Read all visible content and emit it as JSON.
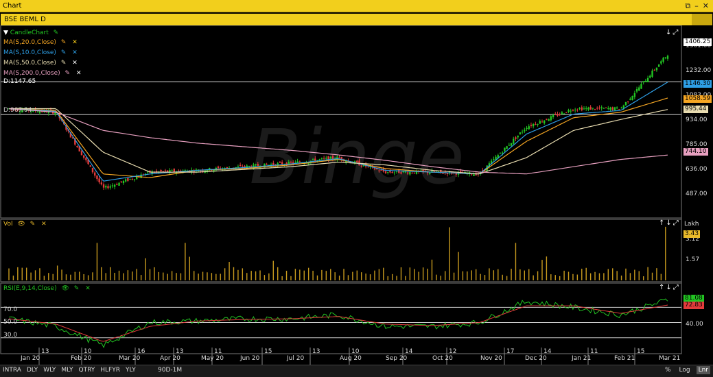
{
  "window": {
    "title": "Chart",
    "header": "BSE BEML D"
  },
  "legend": {
    "candle": "CandleChart",
    "ma": [
      {
        "label": "MA(S,20.0,Close)",
        "color": "#f5a623"
      },
      {
        "label": "MA(S,10.0,Close)",
        "color": "#2e9fe6"
      },
      {
        "label": "MA(S,50.0,Close)",
        "color": "#e8dcb0"
      },
      {
        "label": "MA(S,200.0,Close)",
        "color": "#e8a0c0"
      }
    ],
    "dline": "D:1147.65",
    "dline2": "D:967.94"
  },
  "price_axis": {
    "labels": [
      "1361.00",
      "1232.00",
      "1083.00",
      "934.00",
      "785.00",
      "636.00",
      "487.00"
    ],
    "tags": [
      {
        "text": "1406.25",
        "color": "#ffffff"
      },
      {
        "text": "1146.30",
        "color": "#2e9fe6"
      },
      {
        "text": "1058.59",
        "color": "#f5a623"
      },
      {
        "text": "995.44",
        "color": "#e8dcb0"
      },
      {
        "text": "744.10",
        "color": "#e8a0c0"
      }
    ]
  },
  "vol": {
    "label": "Vol",
    "unit": "Lakh",
    "axis": [
      "3.12",
      "1.57"
    ],
    "tag": "3.43"
  },
  "rsi": {
    "label": "RSI(E,9,14,Close)",
    "levels": [
      "70.0",
      "50.0",
      "30.0"
    ],
    "axis": "40.00",
    "tags": [
      {
        "text": "81.08",
        "color": "#22c422"
      },
      {
        "text": "72.83",
        "color": "#e23b3b"
      }
    ]
  },
  "xaxis": {
    "days": [
      "13",
      "10",
      "16",
      "13",
      "11",
      "15",
      "13",
      "10",
      "14",
      "12",
      "17",
      "14",
      "11",
      "15"
    ],
    "months": [
      "Jan 20",
      "Feb 20",
      "Mar 20",
      "Apr 20",
      "May 20",
      "Jun 20",
      "Jul 20",
      "Aug 20",
      "Sep 20",
      "Oct 20",
      "Nov 20",
      "Dec 20",
      "Jan 21",
      "Feb 21",
      "Mar 21"
    ]
  },
  "watermark": "Binge",
  "bottom": {
    "timeframes": [
      "INTRA",
      "DLY",
      "WLY",
      "MLY",
      "QTRY",
      "HLFYR",
      "YLY"
    ],
    "range": "90D-1M",
    "scale": [
      "%",
      "Log",
      "Lnr"
    ]
  },
  "chart_data": {
    "type": "line",
    "title": "BSE BEML D",
    "x": [
      "Jan 20",
      "Feb 20",
      "Mar 20",
      "Apr 20",
      "May 20",
      "Jun 20",
      "Jul 20",
      "Aug 20",
      "Sep 20",
      "Oct 20",
      "Nov 20",
      "Dec 20",
      "Jan 21",
      "Feb 21",
      "Mar 21"
    ],
    "series": [
      {
        "name": "CandleChart",
        "values": [
          1000,
          980,
          560,
          650,
          660,
          680,
          700,
          730,
          650,
          650,
          640,
          900,
          1000,
          1000,
          1300
        ]
      },
      {
        "name": "MA(S,20.0,Close)",
        "values": [
          1000,
          990,
          640,
          620,
          660,
          670,
          690,
          720,
          670,
          650,
          640,
          820,
          950,
          980,
          1058.59
        ]
      },
      {
        "name": "MA(S,10.0,Close)",
        "values": [
          1000,
          985,
          600,
          640,
          660,
          675,
          695,
          725,
          660,
          650,
          640,
          860,
          970,
          990,
          1146.3
        ]
      },
      {
        "name": "MA(S,50.0,Close)",
        "values": [
          1000,
          1000,
          760,
          650,
          650,
          665,
          680,
          705,
          690,
          660,
          640,
          730,
          880,
          940,
          995.44
        ]
      },
      {
        "name": "MA(S,200.0,Close)",
        "values": [
          1000,
          980,
          880,
          840,
          810,
          790,
          770,
          745,
          715,
          680,
          650,
          640,
          680,
          720,
          744.1
        ]
      }
    ],
    "ylim": [
      420,
      1440
    ],
    "volume_ylim": [
      0,
      3.6
    ],
    "rsi_ylim": [
      10,
      100
    ]
  }
}
